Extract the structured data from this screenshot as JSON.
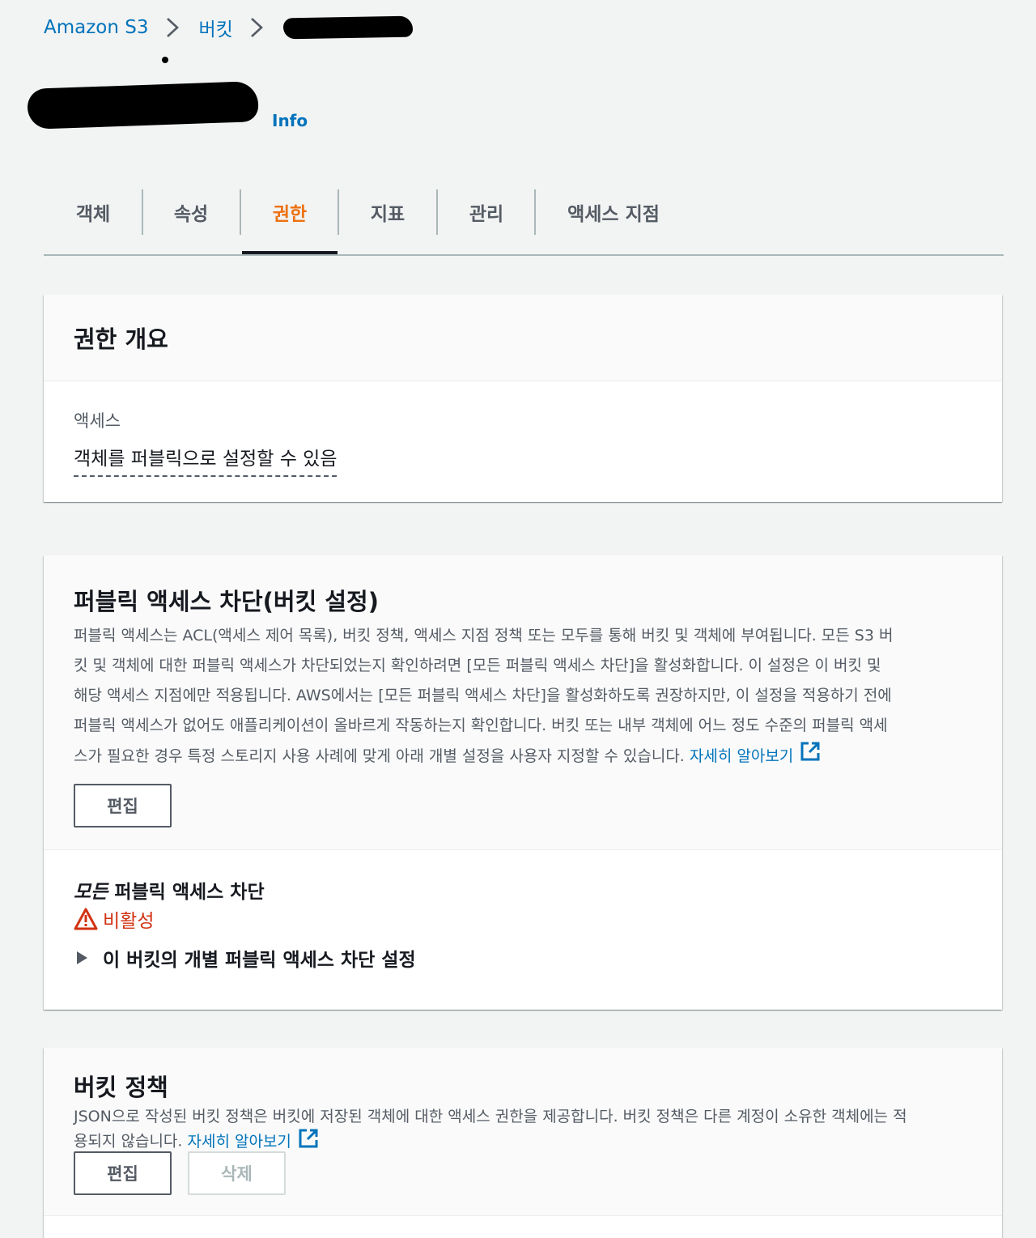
{
  "breadcrumb": {
    "root": "Amazon S3",
    "buckets": "버킷"
  },
  "header": {
    "info": "Info"
  },
  "tabs": [
    {
      "label": "객체"
    },
    {
      "label": "속성"
    },
    {
      "label": "권한",
      "active": true
    },
    {
      "label": "지표"
    },
    {
      "label": "관리"
    },
    {
      "label": "액세스 지점"
    }
  ],
  "overview": {
    "title": "권한 개요",
    "access_label": "액세스",
    "access_value": "객체를 퍼블릭으로 설정할 수 있음"
  },
  "block_public": {
    "title": "퍼블릭 액세스 차단(버킷 설정)",
    "desc_lines": [
      "퍼블릭 액세스는 ACL(액세스 제어 목록), 버킷 정책, 액세스 지점 정책 또는 모두를 통해 버킷 및 객체에 부여됩니다. 모든 S3 버",
      "킷 및 객체에 대한 퍼블릭 액세스가 차단되었는지 확인하려면 [모든 퍼블릭 액세스 차단]을 활성화합니다. 이 설정은 이 버킷 및",
      "해당 액세스 지점에만 적용됩니다. AWS에서는 [모든 퍼블릭 액세스 차단]을 활성화하도록 권장하지만, 이 설정을 적용하기 전에",
      "퍼블릭 액세스가 없어도 애플리케이션이 올바르게 작동하는지 확인합니다. 버킷 또는 내부 객체에 어느 정도 수준의 퍼블릭 액세",
      "스가 필요한 경우 특정 스토리지 사용 사례에 맞게 아래 개별 설정을 사용자 지정할 수 있습니다."
    ],
    "learn_more": "자세히 알아보기",
    "edit_button": "편집",
    "setting_label_em": "모든",
    "setting_label_rest": " 퍼블릭 액세스 차단",
    "status": "비활성",
    "expander_label": "이 버킷의 개별 퍼블릭 액세스 차단 설정"
  },
  "bucket_policy": {
    "title": "버킷 정책",
    "desc_line1": "JSON으로 작성된 버킷 정책은 버킷에 저장된 객체에 대한 액세스 권한을 제공합니다. 버킷 정책은 다른 계정이 소유한 객체에는 적",
    "desc_line2": "용되지 않습니다.",
    "learn_more": "자세히 알아보기",
    "edit_button": "편집",
    "delete_button": "삭제"
  },
  "colors": {
    "link": "#0073bb",
    "active_tab": "#ec7211",
    "warning": "#d13212"
  }
}
